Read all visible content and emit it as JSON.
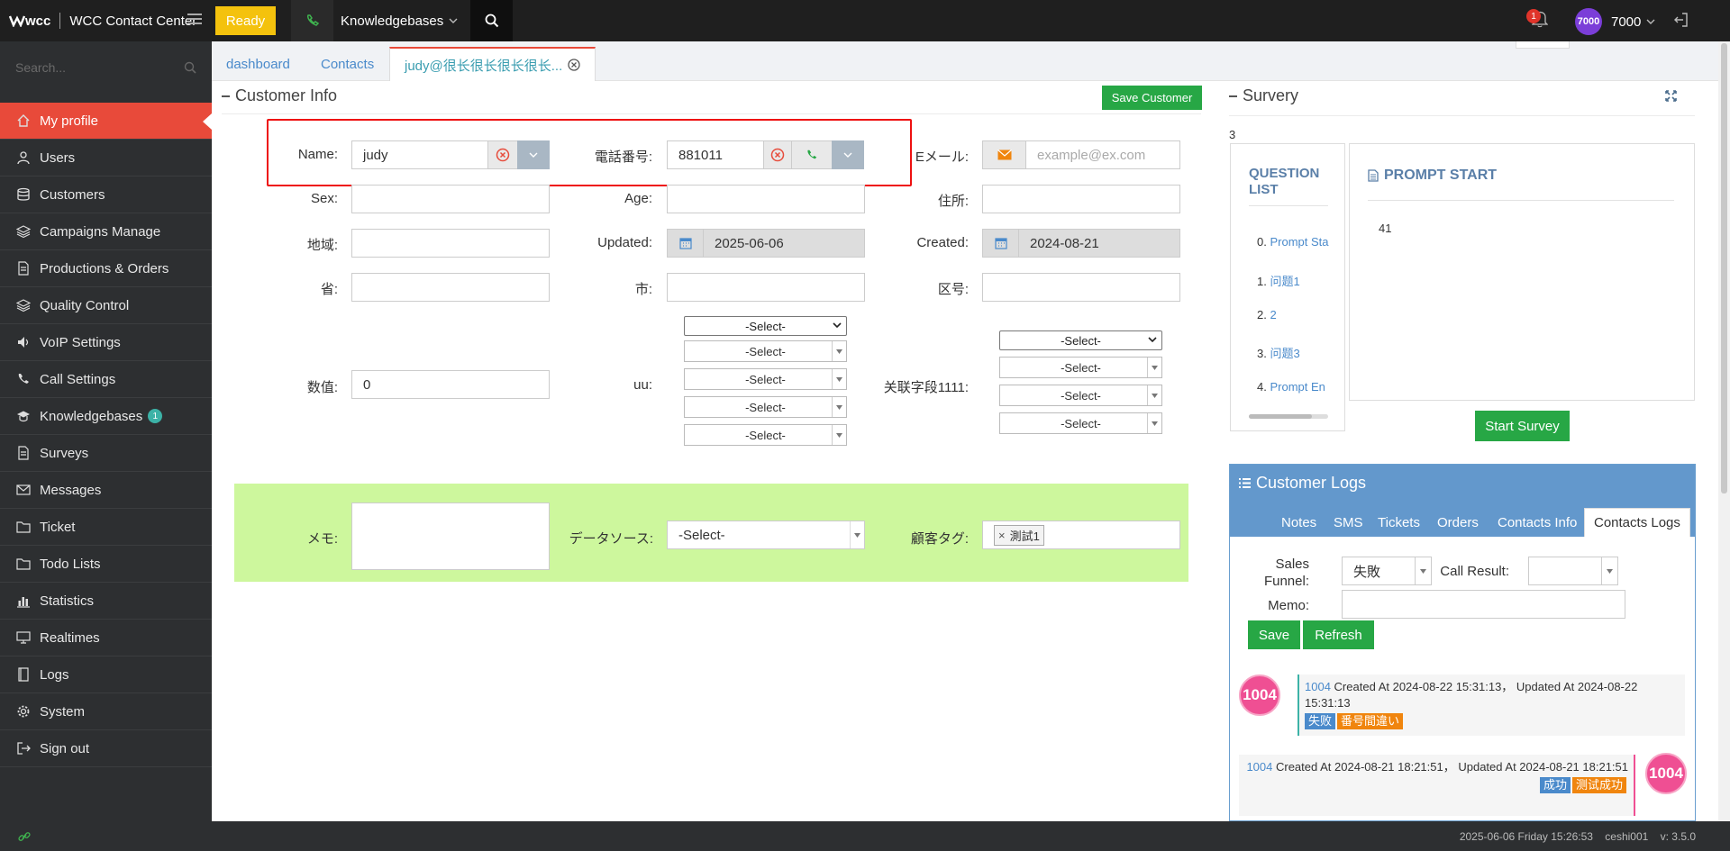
{
  "topbar": {
    "logo": "wcc",
    "app_title": "WCC Contact Center",
    "status_button": "Ready",
    "module_menu": "Knowledgebases",
    "notification_count": "1",
    "avatar_text": "7000",
    "user_name": "7000"
  },
  "sidebar": {
    "search_placeholder": "Search...",
    "items": [
      {
        "label": "My profile",
        "icon": "home-icon",
        "active": true
      },
      {
        "label": "Users",
        "icon": "user-icon"
      },
      {
        "label": "Customers",
        "icon": "database-icon"
      },
      {
        "label": "Campaigns Manage",
        "icon": "layers-icon"
      },
      {
        "label": "Productions & Orders",
        "icon": "document-icon"
      },
      {
        "label": "Quality Control",
        "icon": "layers-icon"
      },
      {
        "label": "VoIP Settings",
        "icon": "volume-icon"
      },
      {
        "label": "Call Settings",
        "icon": "phone-icon"
      },
      {
        "label": "Knowledgebases",
        "icon": "graduation-cap-icon",
        "badge": "1"
      },
      {
        "label": "Surveys",
        "icon": "document-icon"
      },
      {
        "label": "Messages",
        "icon": "envelope-icon"
      },
      {
        "label": "Ticket",
        "icon": "folder-icon"
      },
      {
        "label": "Todo Lists",
        "icon": "folder-icon"
      },
      {
        "label": "Statistics",
        "icon": "bar-chart-icon"
      },
      {
        "label": "Realtimes",
        "icon": "monitor-icon"
      },
      {
        "label": "Logs",
        "icon": "book-icon"
      },
      {
        "label": "System",
        "icon": "gear-icon"
      },
      {
        "label": "Sign out",
        "icon": "sign-out-icon"
      }
    ]
  },
  "tabs": [
    {
      "label": "dashboard"
    },
    {
      "label": "Contacts"
    },
    {
      "label": "judy@很长很长很长很长...",
      "active": true
    }
  ],
  "customer_info": {
    "title": "Customer Info",
    "save_label": "Save Customer",
    "fields": {
      "name_label": "Name:",
      "name_value": "judy",
      "phone_label": "電話番号:",
      "phone_value": "881011",
      "email_label": "Eメール:",
      "email_placeholder": "example@ex.com",
      "sex_label": "Sex:",
      "age_label": "Age:",
      "address_label": "住所:",
      "region_label": "地域:",
      "updated_label": "Updated:",
      "updated_value": "2025-06-06",
      "created_label": "Created:",
      "created_value": "2024-08-21",
      "province_label": "省:",
      "city_label": "市:",
      "district_label": "区号:",
      "number_label": "数值:",
      "number_value": "0",
      "uu_label": "uu:",
      "related_label": "关联字段1111:",
      "select_placeholder": "-Select-",
      "memo_label": "メモ:",
      "datasource_label": "データソース:",
      "datasource_value": "-Select-",
      "tag_label": "顧客タグ:",
      "tag_value": "測試1"
    }
  },
  "survey": {
    "title": "Survery",
    "count": "3",
    "question_list_title": "QUESTION LIST",
    "questions": [
      {
        "num": "0.",
        "label": "Prompt Sta"
      },
      {
        "num": "1.",
        "label": "问题1"
      },
      {
        "num": "2.",
        "label": "2"
      },
      {
        "num": "3.",
        "label": "问题3"
      },
      {
        "num": "4.",
        "label": "Prompt En"
      }
    ],
    "prompt_title": "PROMPT START",
    "prompt_value": "41",
    "start_label": "Start Survey"
  },
  "customer_logs": {
    "title": "Customer Logs",
    "tabs": [
      "Notes",
      "SMS",
      "Tickets",
      "Orders",
      "Contacts Info",
      "Contacts Logs"
    ],
    "sales_funnel_label": "Sales Funnel:",
    "sales_funnel_value": "失敗",
    "call_result_label": "Call Result:",
    "memo_label": "Memo:",
    "save_label": "Save",
    "refresh_label": "Refresh",
    "logs": [
      {
        "avatar": "1004",
        "id": "1004",
        "text": "Created At 2024-08-22 15:31:13， Updated At 2024-08-22 15:31:13",
        "tags": [
          "失败",
          "番号間違い"
        ]
      },
      {
        "avatar": "1004",
        "id": "1004",
        "text": "Created At 2024-08-21 18:21:51， Updated At 2024-08-21 18:21:51",
        "tags": [
          "成功",
          "测试成功"
        ]
      }
    ]
  },
  "statusbar": {
    "text": "2025-06-06 Friday 15:26:53    ceshi001    v: 3.5.0"
  },
  "colors": {
    "accent_red": "#e84a3a",
    "ready_yellow": "#f4c20d",
    "success_green": "#27a745",
    "logs_blue": "#6398cc",
    "panel_green": "#cdf79d"
  }
}
